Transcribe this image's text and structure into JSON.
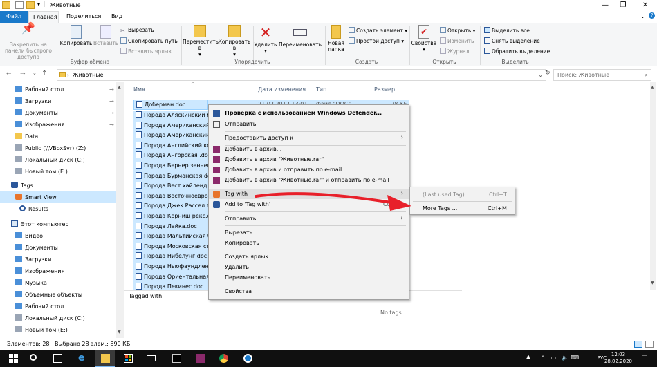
{
  "window": {
    "title": "Животные"
  },
  "ribbon_tabs": [
    "Файл",
    "Главная",
    "Поделиться",
    "Вид"
  ],
  "ribbon": {
    "pin_label": "Закрепить на панели быстрого доступа",
    "copy_label": "Копировать",
    "paste_label": "Вставить",
    "cut_label": "Вырезать",
    "copy_path_label": "Скопировать путь",
    "paste_shortcut_label": "Вставить ярлык",
    "group_clipboard": "Буфер обмена",
    "move_to_label": "Переместить в",
    "copy_to_label": "Копировать в",
    "delete_label": "Удалить",
    "rename_label": "Переименовать",
    "group_organize": "Упорядочить",
    "new_folder_label": "Новая папка",
    "new_item_label": "Создать элемент",
    "easy_access_label": "Простой доступ",
    "group_new": "Создать",
    "properties_label": "Свойства",
    "open_label": "Открыть",
    "edit_label": "Изменить",
    "history_label": "Журнал",
    "group_open": "Открыть",
    "select_all_label": "Выделить все",
    "select_none_label": "Снять выделение",
    "invert_selection_label": "Обратить выделение",
    "group_select": "Выделить"
  },
  "address": {
    "path": "Животные",
    "search_placeholder": "Поиск: Животные"
  },
  "nav": {
    "quick": [
      {
        "label": "Рабочий стол",
        "icon": "desktop-icon",
        "pinned": true
      },
      {
        "label": "Загрузки",
        "icon": "download-icon",
        "pinned": true
      },
      {
        "label": "Документы",
        "icon": "documents-icon",
        "pinned": true
      },
      {
        "label": "Изображения",
        "icon": "pictures-icon",
        "pinned": true
      },
      {
        "label": "Data",
        "icon": "folder-icon",
        "pinned": false
      },
      {
        "label": "Public (\\\\VBoxSvr) (Z:)",
        "icon": "network-drive-icon",
        "pinned": false
      },
      {
        "label": "Локальный диск (C:)",
        "icon": "drive-icon",
        "pinned": false
      },
      {
        "label": "Новый том (E:)",
        "icon": "drive-icon",
        "pinned": false
      }
    ],
    "tags_label": "Tags",
    "smart_view_label": "Smart View",
    "results_label": "Results",
    "this_pc_label": "Этот компьютер",
    "pc": [
      {
        "label": "Видео",
        "icon": "video-icon"
      },
      {
        "label": "Документы",
        "icon": "documents-icon"
      },
      {
        "label": "Загрузки",
        "icon": "download-icon"
      },
      {
        "label": "Изображения",
        "icon": "pictures-icon"
      },
      {
        "label": "Музыка",
        "icon": "music-icon"
      },
      {
        "label": "Объемные объекты",
        "icon": "3d-objects-icon"
      },
      {
        "label": "Рабочий стол",
        "icon": "desktop-icon"
      },
      {
        "label": "Локальный диск (C:)",
        "icon": "drive-icon"
      },
      {
        "label": "Новый том (E:)",
        "icon": "drive-icon"
      }
    ]
  },
  "columns": {
    "name": "Имя",
    "date": "Дата изменения",
    "type": "Тип",
    "size": "Размер"
  },
  "first_file": {
    "name": "Доберман.doc",
    "date": "21.02.2012 13:01",
    "type": "Файл \"DOC\"",
    "size": "28 КБ"
  },
  "files": [
    "Порода Аляскинский ма",
    "Порода Американский б",
    "Порода Американский к",
    "Порода Английский кок",
    "Порода Ангорская .doc",
    "Порода Бернер зенненх",
    "Порода Бурманская.doc",
    "Порода Вест хайленд ва",
    "Порода Восточноевропе",
    "Порода Джек Рассел тер",
    "Порода Корниш рекс.do",
    "Порода Лайка.doc",
    "Порода Мальтийская бо",
    "Порода Московская сто",
    "Порода Нибелунг.doc",
    "Порода Ньюфаундленд",
    "Порода Ориентальная к",
    "Порода Пекинес.doc"
  ],
  "context_menu": {
    "defender": "Проверка с использованием Windows Defender...",
    "send": "Отправить",
    "share": "Предоставить доступ к",
    "add_archive": "Добавить в архив...",
    "add_rar": "Добавить в архив \"Животные.rar\"",
    "add_email": "Добавить в архив и отправить по e-mail...",
    "add_rar_email": "Добавить в архив \"Животные.rar\" и отправить по e-mail",
    "tag_with": "Tag with",
    "add_to_tag": "Add to 'Tag with'",
    "add_to_tag_shortcut": "Ctrl+G",
    "send_to": "Отправить",
    "cut": "Вырезать",
    "copy": "Копировать",
    "create_shortcut": "Создать ярлык",
    "delete": "Удалить",
    "rename": "Переименовать",
    "properties": "Свойства"
  },
  "submenu": {
    "last_used": "(Last used Tag)",
    "last_used_shortcut": "Ctrl+T",
    "more_tags": "More Tags ...",
    "more_tags_shortcut": "Ctrl+M"
  },
  "detail": {
    "tagged_with": "Tagged with",
    "no_tags": "No tags."
  },
  "status": {
    "count": "Элементов: 28",
    "selected": "Выбрано 28 элем.: 890 КБ"
  },
  "tray": {
    "lang": "РУС",
    "time": "12:03",
    "date": "28.02.2020"
  },
  "colors": {
    "accent": "#1979ca",
    "selection": "#cce8ff",
    "arrow": "#e8202a"
  }
}
